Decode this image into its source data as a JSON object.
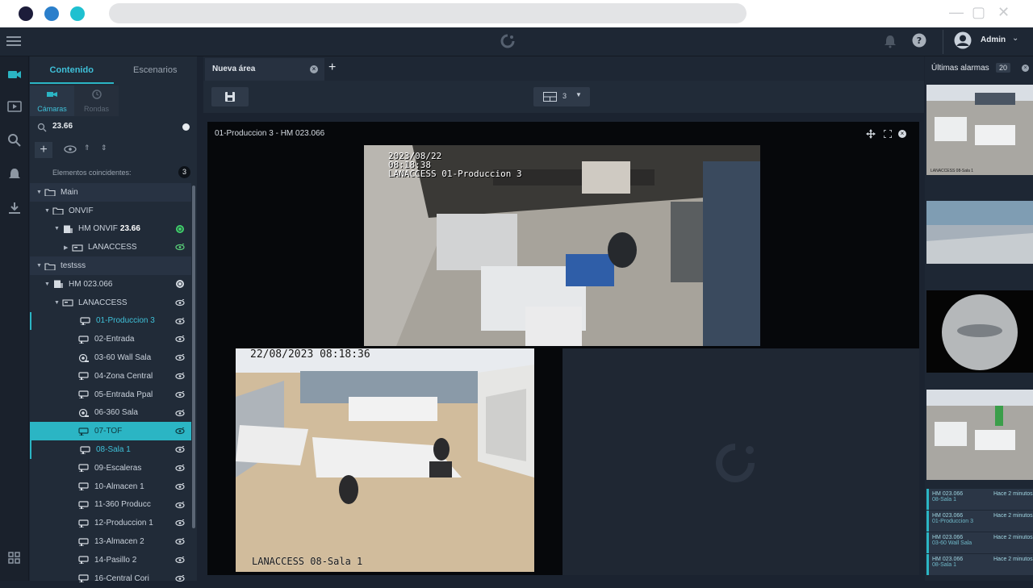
{
  "browser": {
    "dots": [
      "#1c1c3a",
      "#2b7fcb",
      "#1fc0d0"
    ]
  },
  "topbar": {
    "user": "Admin"
  },
  "left": {
    "tabs": [
      "Contenido",
      "Escenarios"
    ],
    "subtabs": [
      "Cámaras",
      "Rondas"
    ],
    "search_value": "23.66",
    "matches_label": "Elementos coincidentes:",
    "matches_count": "3",
    "tree": [
      {
        "label": "Main",
        "type": "group",
        "indent": 0,
        "expanded": true
      },
      {
        "label": "ONVIF",
        "type": "folder",
        "indent": 1,
        "expanded": true
      },
      {
        "label": "HM ONVIF",
        "label_bold": "23.66",
        "type": "server",
        "indent": 2,
        "status": "green"
      },
      {
        "label": "LANACCESS",
        "type": "recorder",
        "indent": 3,
        "eye": true
      },
      {
        "label": "testsss",
        "type": "group",
        "indent": 0,
        "expanded": true
      },
      {
        "label": "HM 023.066",
        "type": "server",
        "indent": 1,
        "status": "white"
      },
      {
        "label": "LANACCESS",
        "type": "recorder",
        "indent": 2,
        "eye": true
      },
      {
        "label": "01-Produccion 3",
        "type": "camera",
        "indent": 4,
        "eye": true,
        "active": true
      },
      {
        "label": "02-Entrada",
        "type": "camera",
        "indent": 4,
        "eye": true
      },
      {
        "label": "03-60 Wall Sala",
        "type": "dome",
        "indent": 4,
        "eye": true
      },
      {
        "label": "04-Zona Central",
        "type": "camera",
        "indent": 4,
        "eye": true
      },
      {
        "label": "05-Entrada Ppal",
        "type": "camera",
        "indent": 4,
        "eye": true
      },
      {
        "label": "06-360 Sala",
        "type": "dome",
        "indent": 4,
        "eye": true
      },
      {
        "label": "07-TOF",
        "type": "camera",
        "indent": 4,
        "eye": true,
        "selected": true
      },
      {
        "label": "08-Sala 1",
        "type": "camera",
        "indent": 4,
        "eye": true,
        "active": true
      },
      {
        "label": "09-Escaleras",
        "type": "camera",
        "indent": 4,
        "eye": true
      },
      {
        "label": "10-Almacen 1",
        "type": "camera",
        "indent": 4,
        "eye": true
      },
      {
        "label": "11-360 Producc",
        "type": "camera",
        "indent": 4,
        "eye": true
      },
      {
        "label": "12-Produccion 1",
        "type": "camera",
        "indent": 4,
        "eye": true
      },
      {
        "label": "13-Almacen 2",
        "type": "camera",
        "indent": 4,
        "eye": true
      },
      {
        "label": "14-Pasillo 2",
        "type": "camera",
        "indent": 4,
        "eye": true
      },
      {
        "label": "16-Central Cori",
        "type": "camera",
        "indent": 4,
        "eye": true
      }
    ]
  },
  "main": {
    "tab_label": "Nueva área",
    "layout_value": "3",
    "cam_title": "01-Produccion 3 - HM 023.066",
    "video1": {
      "osd_date": "2023/08/22",
      "osd_time": "08:18:38",
      "osd_name": "LANACCESS 01-Produccion 3"
    },
    "video2": {
      "osd_datetime": "22/08/2023 08:18:36",
      "osd_name": "LANACCESS 08-Sala 1"
    }
  },
  "right": {
    "title": "Últimas alarmas",
    "count": "20",
    "thumb_caption": "LANACCESS 08-Sala 1",
    "alarms": [
      {
        "server": "HM 023.066",
        "camera": "08-Sala 1",
        "when": "Hace 2 minutos"
      },
      {
        "server": "HM 023.066",
        "camera": "01-Produccion 3",
        "when": "Hace 2 minutos"
      },
      {
        "server": "HM 023.066",
        "camera": "03-60 Wall Sala",
        "when": "Hace 2 minutos"
      },
      {
        "server": "HM 023.066",
        "camera": "08-Sala 1",
        "when": "Hace 2 minutos"
      }
    ]
  },
  "colors": {
    "accent": "#2bb5c4",
    "bg": "#1b2330",
    "panel": "#212b38"
  }
}
